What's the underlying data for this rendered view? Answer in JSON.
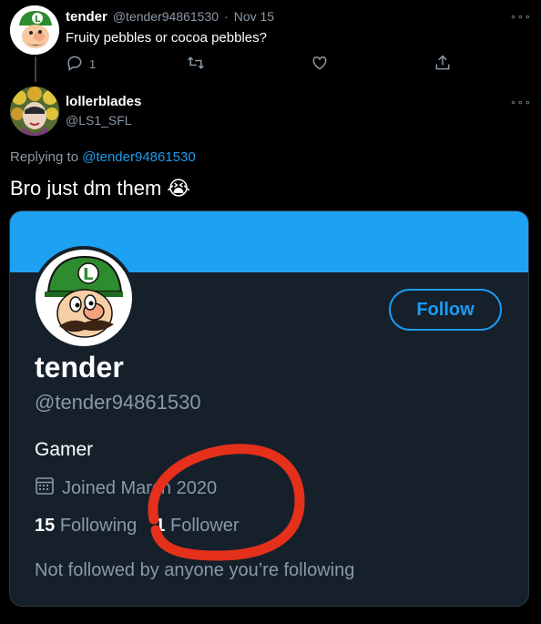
{
  "parent_tweet": {
    "name": "tender",
    "handle": "@tender94861530",
    "date": "Nov 15",
    "separator": "·",
    "text": "Fruity pebbles or cocoa pebbles?",
    "reply_count": "1",
    "more_glyph": "∘∘∘"
  },
  "reply_tweet": {
    "name": "lollerblades",
    "handle": "@LS1_SFL",
    "replying_prefix": "Replying to",
    "replying_to": "@tender94861530",
    "text": "Bro just dm them",
    "emoji": "😭",
    "more_glyph": "∘∘∘"
  },
  "profile_card": {
    "follow_label": "Follow",
    "name": "tender",
    "handle": "@tender94861530",
    "bio": "Gamer",
    "joined": "Joined March 2020",
    "following_count": "15",
    "following_label": "Following",
    "followers_count": "1",
    "followers_label": "Follower",
    "note": "Not followed by anyone you’re following",
    "banner_color": "#1da1f2",
    "annotation_color": "#e5301b"
  },
  "icons": {
    "reply": "reply-icon",
    "retweet": "retweet-icon",
    "like": "heart-icon",
    "share": "share-icon",
    "calendar": "calendar-icon"
  }
}
